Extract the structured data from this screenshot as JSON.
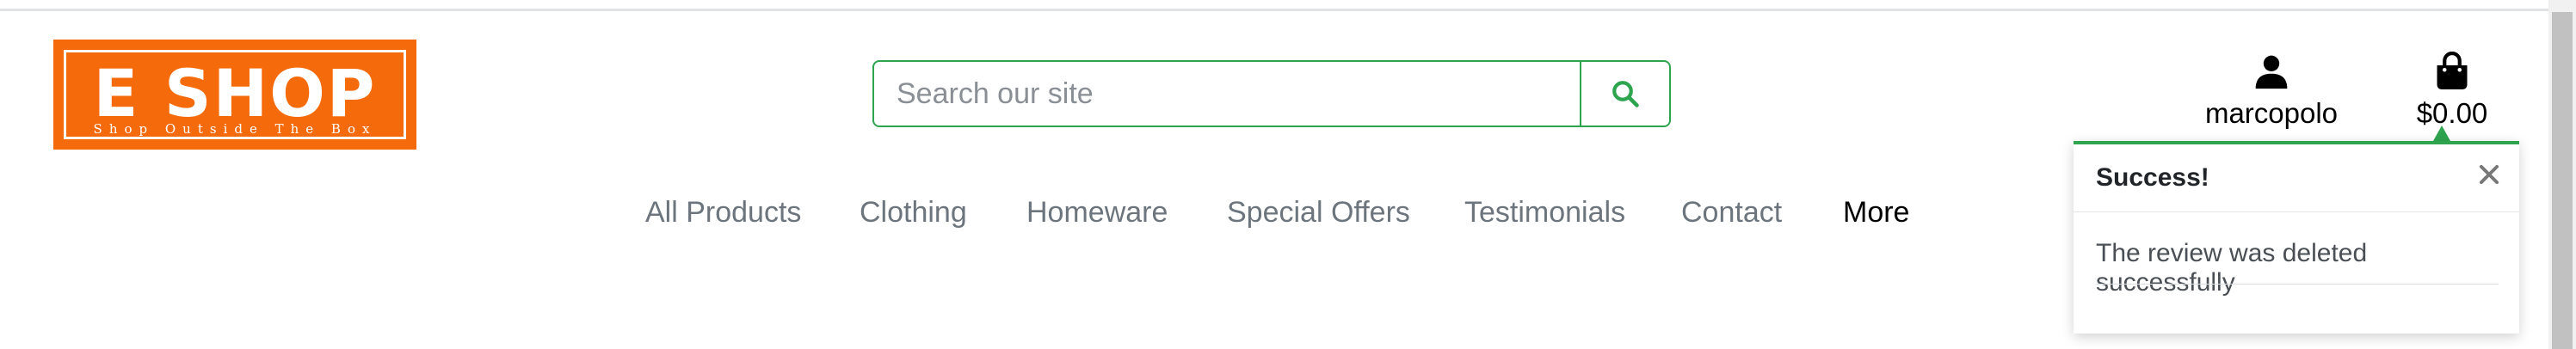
{
  "logo": {
    "title": "E SHOP",
    "tagline": "Shop Outside The Box"
  },
  "search": {
    "placeholder": "Search our site",
    "icon": "search-icon"
  },
  "account": {
    "username": "marcopolo",
    "icon": "user-icon"
  },
  "bag": {
    "total": "$0.00",
    "icon": "shopping-bag-icon"
  },
  "nav": {
    "items": [
      "All Products",
      "Clothing",
      "Homeware",
      "Special Offers",
      "Testimonials",
      "Contact",
      "More"
    ]
  },
  "toast": {
    "title": "Success!",
    "message": "The review was deleted successfully",
    "close_icon": "close-icon"
  },
  "colors": {
    "brand": "#f56a0a",
    "accent": "#2ea44f",
    "nav_text": "#6c757d"
  }
}
